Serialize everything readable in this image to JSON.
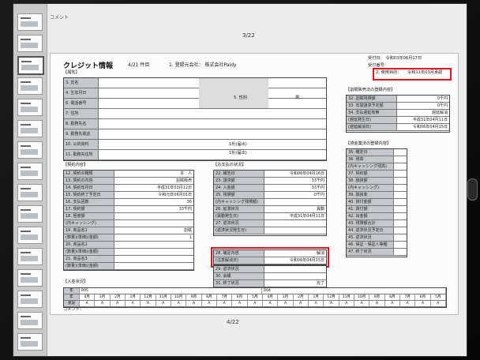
{
  "viewer": {
    "top_comment": "コメント",
    "page_top": "3/22",
    "page_bottom": "4/22",
    "thumbnail_count": 16
  },
  "report": {
    "title": "クレジット情報",
    "item_count": "4/21 件目",
    "company": "1. 登録元会社：  株式会社Paidy",
    "received_date": "受付日：   令和03年06月17日",
    "received_no": "受付番号：",
    "usage_label": "2. 使用目的：",
    "usage_value": "令和11年03月承認",
    "section_owner": "【属性】",
    "owner_rows": [
      {
        "label": "3. 氏名",
        "value": ""
      },
      {
        "label": "4. 生年月日",
        "value": ""
      },
      {
        "label": "6. 電話番号",
        "value": ""
      },
      {
        "label": "7. 住所",
        "value": ""
      },
      {
        "label": "8. 勤務先名",
        "value": ""
      },
      {
        "label": "9. 勤務先電話",
        "value": ""
      },
      {
        "label": "10. 公的資料",
        "value": ""
      },
      {
        "label": "11. 勤務先住所",
        "value": ""
      }
    ],
    "gender_label": "5. 性別",
    "gender_value": "男",
    "doc_label_1": "1桁(届出)",
    "doc_label_2": "1桁(届出)",
    "section_contract": "【契約内容】",
    "contract_rows": [
      {
        "label": "12. 契約の種類",
        "value": "本　人"
      },
      {
        "label": "13. 契約の内容",
        "value": "割賦販売"
      },
      {
        "label": "14. 契約年月日",
        "value": "平成31年03月12日"
      },
      {
        "label": "15. 契約終了予定日",
        "value": "令和元年06月01日"
      },
      {
        "label": "16. 支払回数",
        "value": "36"
      },
      {
        "label": "17. 契約額",
        "value": "33千円"
      },
      {
        "label": "18. 極度額",
        "value": ""
      },
      {
        "label": "(内キャッシング)",
        "value": ""
      },
      {
        "label": "19. 商品名1",
        "value": "割賦"
      },
      {
        "label": "(数量)(単価)(金額)",
        "value": "1"
      },
      {
        "label": "20. 商品名2",
        "value": ""
      },
      {
        "label": "(数量)(単価)(金額)",
        "value": ""
      },
      {
        "label": "21. 商品名3",
        "value": ""
      },
      {
        "label": "(数量)(単価)(金額)",
        "value": ""
      }
    ],
    "section_status": "【お支払の状況】",
    "status_rows": [
      {
        "label": "22. 報告日",
        "value": "令和06年04月16日"
      },
      {
        "label": "23. 請求額",
        "value": "33千円"
      },
      {
        "label": "24. 入金額",
        "value": "33千円"
      },
      {
        "label": "25. 残債額",
        "value": "0千円"
      },
      {
        "label": "(内キャッシング残債額)",
        "value": ""
      },
      {
        "label": "26. 延滞状況",
        "value": "異動"
      },
      {
        "label": "(異動発生日)",
        "value": "平成31年04月11日"
      },
      {
        "label": "27. 返済状況",
        "value": ""
      },
      {
        "label": "(返済状況発生日)",
        "value": ""
      }
    ],
    "status_rows_after": [
      {
        "label": "29. 返済状況",
        "value": ""
      },
      {
        "label": "30. 会報",
        "value": ""
      },
      {
        "label": "31. 終了状況",
        "value": "完了"
      }
    ],
    "kaishu_label": "28. 補足内容",
    "kaishu_value": "解消",
    "kaishu_date_label": "(注意解消日)",
    "kaishu_date_value": "令和06年04月15日",
    "section_other": "【割賦販売法の登録内容】",
    "other_rows": [
      {
        "label": "32. 割賦残債額",
        "value": "0千円"
      },
      {
        "label": "33. 年間請求予定額",
        "value": "0千円"
      },
      {
        "label": "34. 支払遅延有無",
        "value": "遅延解消"
      },
      {
        "label": "(遅延発生日)",
        "value": "平成31年04月11日"
      },
      {
        "label": "(遅延解消日)",
        "value": "令和06年04月15日"
      }
    ],
    "section_loan": "【貸金業法の登録内容】",
    "loan_rows": [
      {
        "label": "35. 確定日",
        "value": ""
      },
      {
        "label": "36. 残高",
        "value": ""
      },
      {
        "label": "(内キャッシング残高)",
        "value": ""
      },
      {
        "label": "37. 契約額",
        "value": ""
      },
      {
        "label": "38. 融資額",
        "value": ""
      },
      {
        "label": "(内キャッシング)",
        "value": ""
      },
      {
        "label": "39. 融資率",
        "value": ""
      },
      {
        "label": "40. 貸付金額",
        "value": ""
      },
      {
        "label": "41. 賃付額",
        "value": ""
      },
      {
        "label": "42. 出金額",
        "value": ""
      },
      {
        "label": "43. 残債額合計",
        "value": ""
      },
      {
        "label": "44. 返済状況予定日",
        "value": ""
      },
      {
        "label": "45. 返済状況",
        "value": ""
      },
      {
        "label": "46. 保証・保証人等種",
        "value": ""
      },
      {
        "label": "47. 終了状況",
        "value": ""
      }
    ],
    "section_calendar": "【入金状況】",
    "cal_label": "年",
    "cal_year_1": "R05",
    "cal_year_2": "R04",
    "cal_row_label": "状況",
    "cal_months": [
      "4月",
      "3月",
      "2月",
      "1月",
      "12月",
      "11月",
      "10月",
      "9月",
      "8月",
      "7月",
      "6月",
      "5月",
      "4月",
      "3月",
      "2月",
      "1月",
      "12月",
      "11月",
      "10月",
      "9月",
      "8月",
      "7月",
      "6月",
      "5月"
    ],
    "cal_statuses": [
      "A",
      "A",
      "A",
      "A",
      "A",
      "A",
      "A",
      "A",
      "A",
      "A",
      "A",
      "A",
      "A",
      "A",
      "A",
      "A",
      "A",
      "A",
      "A",
      "A",
      "A",
      "A",
      "A",
      "A"
    ],
    "bottom_comment": "コメント："
  }
}
